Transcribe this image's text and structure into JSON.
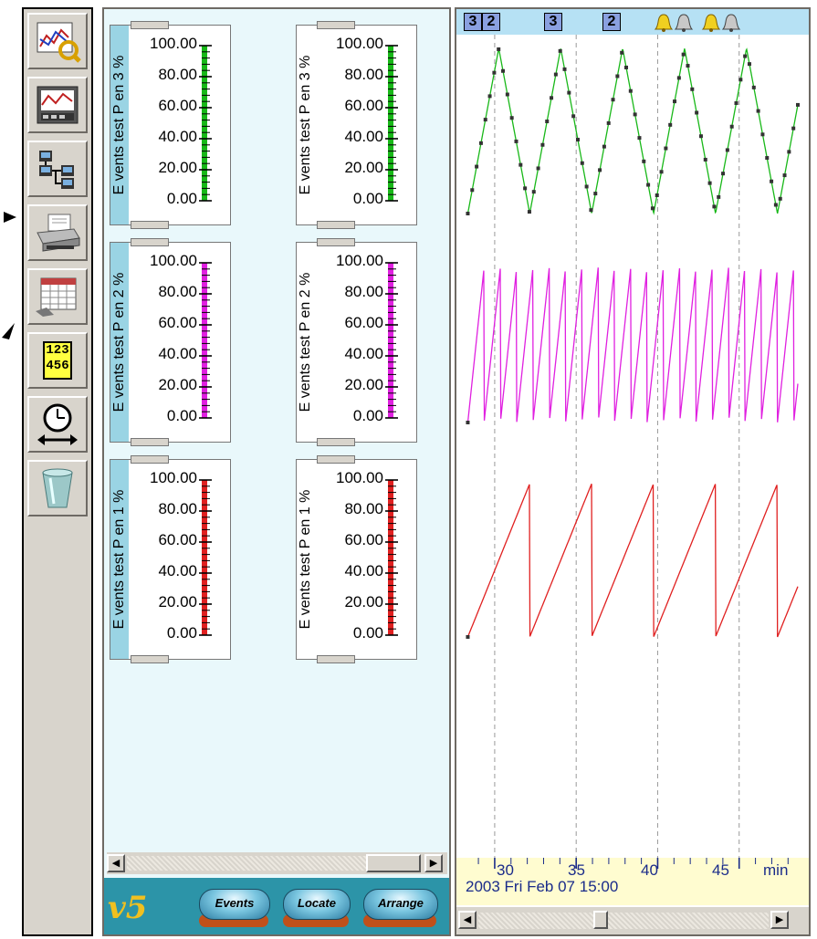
{
  "toolbar": {
    "buttons": [
      {
        "name": "trend-analysis-button",
        "icon": "chart-magnifier-icon"
      },
      {
        "name": "recorder-view-button",
        "icon": "recorder-screen-icon"
      },
      {
        "name": "network-button",
        "icon": "network-tree-icon"
      },
      {
        "name": "print-button",
        "icon": "printer-icon"
      },
      {
        "name": "calendar-button",
        "icon": "calendar-icon"
      },
      {
        "name": "digital-display-button",
        "icon": "digits-icon",
        "text_top": "123",
        "text_bottom": "456"
      },
      {
        "name": "time-range-button",
        "icon": "clock-arrow-icon"
      },
      {
        "name": "recycle-bin-button",
        "icon": "trash-bin-icon"
      }
    ]
  },
  "scales": [
    {
      "row": 0,
      "col": 0,
      "label": "E vents test P en 3 %",
      "color": "#18b818",
      "ticks": [
        "100.00",
        "80.00",
        "60.00",
        "40.00",
        "20.00",
        "0.00"
      ],
      "active": true
    },
    {
      "row": 0,
      "col": 1,
      "label": "E vents test P en 3 %",
      "color": "#18b818",
      "ticks": [
        "100.00",
        "80.00",
        "60.00",
        "40.00",
        "20.00",
        "0.00"
      ],
      "active": false
    },
    {
      "row": 1,
      "col": 0,
      "label": "E vents test P en 2 %",
      "color": "#e020e0",
      "ticks": [
        "100.00",
        "80.00",
        "60.00",
        "40.00",
        "20.00",
        "0.00"
      ],
      "active": true
    },
    {
      "row": 1,
      "col": 1,
      "label": "E vents test P en 2 %",
      "color": "#e020e0",
      "ticks": [
        "100.00",
        "80.00",
        "60.00",
        "40.00",
        "20.00",
        "0.00"
      ],
      "active": false
    },
    {
      "row": 2,
      "col": 0,
      "label": "E vents test P en 1 %",
      "color": "#e02020",
      "ticks": [
        "100.00",
        "80.00",
        "60.00",
        "40.00",
        "20.00",
        "0.00"
      ],
      "active": true
    },
    {
      "row": 2,
      "col": 1,
      "label": "E vents test P en 1 %",
      "color": "#e02020",
      "ticks": [
        "100.00",
        "80.00",
        "60.00",
        "40.00",
        "20.00",
        "0.00"
      ],
      "active": false
    }
  ],
  "footer": {
    "logo": "v5",
    "buttons": [
      "Events",
      "Locate",
      "Arrange"
    ]
  },
  "chart_header": {
    "markers": [
      "3",
      "2",
      "3",
      "2"
    ],
    "alarms": [
      "bell-yellow-icon",
      "bell-gray-icon",
      "bell-yellow-icon",
      "bell-gray-icon"
    ]
  },
  "time_axis": {
    "labels": [
      "30",
      "35",
      "40",
      "45"
    ],
    "unit": "min",
    "datetime": "2003 Fri Feb 07  15:00"
  },
  "chart_data": {
    "type": "line",
    "x_unit": "min",
    "xlim": [
      28.1,
      48.6
    ],
    "series": [
      {
        "name": "E vents test P en 3 %",
        "color": "#18b818",
        "shape": "triangle",
        "period_min": 3.8,
        "min": 0,
        "max": 100
      },
      {
        "name": "E vents test P en 2 %",
        "color": "#e020e0",
        "shape": "sawtooth",
        "period_min": 1.0,
        "min": 0,
        "max": 100
      },
      {
        "name": "E vents test P en 1 %",
        "color": "#e02020",
        "shape": "sawtooth",
        "period_min": 3.8,
        "min": 0,
        "max": 100
      }
    ]
  }
}
